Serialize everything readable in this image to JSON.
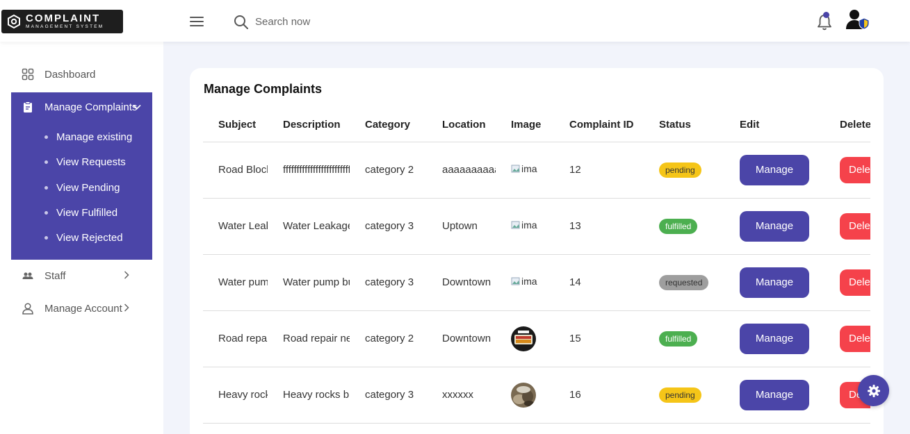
{
  "app": {
    "logo_title": "COMPLAINT",
    "logo_subtitle": "MANAGEMENT SYSTEM"
  },
  "header": {
    "search_placeholder": "Search now",
    "notification_dot_color": "#4b45a8"
  },
  "sidebar": {
    "dashboard": "Dashboard",
    "manage_complaints": "Manage Complaints",
    "sub_items": [
      "Manage existing",
      "View Requests",
      "View Pending",
      "View Fulfilled",
      "View Rejected"
    ],
    "staff": "Staff",
    "manage_account": "Manage Account"
  },
  "main": {
    "title": "Manage Complaints",
    "columns": [
      "Subject",
      "Description",
      "Category",
      "Location",
      "Image",
      "Complaint ID",
      "Status",
      "Edit",
      "Delete"
    ],
    "rows": [
      {
        "subject": "Road Block",
        "description": "fffffffffffffffffffffffffff",
        "category": "category 2",
        "location": "aaaaaaaaaaaa",
        "image": "broken",
        "image_alt": "ima",
        "id": "12",
        "status": "pending",
        "edit": "Manage",
        "delete": "Delete"
      },
      {
        "subject": "Water Leakage",
        "description": "Water Leakage",
        "category": "category 3",
        "location": "Uptown",
        "image": "broken",
        "image_alt": "ima",
        "id": "13",
        "status": "fulfilled",
        "edit": "Manage",
        "delete": "Delete"
      },
      {
        "subject": "Water pump",
        "description": "Water pump bu",
        "category": "category 3",
        "location": "Downtown",
        "image": "broken",
        "image_alt": "ima",
        "id": "14",
        "status": "requested",
        "edit": "Manage",
        "delete": "Delete"
      },
      {
        "subject": "Road repair",
        "description": "Road repair nee",
        "category": "category 2",
        "location": "Downtown",
        "image": "photo-sign",
        "image_alt": "",
        "id": "15",
        "status": "fulfilled",
        "edit": "Manage",
        "delete": "Delete"
      },
      {
        "subject": "Heavy rocks",
        "description": "Heavy rocks blo",
        "category": "category 3",
        "location": "xxxxxx",
        "image": "photo-rocks",
        "image_alt": "",
        "id": "16",
        "status": "pending",
        "edit": "Manage",
        "delete": "Delete"
      }
    ]
  },
  "colors": {
    "accent": "#4b45a8",
    "delete": "#f5424b",
    "pending": "#f5c518",
    "fulfilled": "#4caf50",
    "requested": "#9e9e9e"
  },
  "icons": {
    "logo": "hexagon-logo-icon",
    "menu": "hamburger-icon",
    "search": "search-icon",
    "notifications": "bell-icon",
    "profile": "user-shield-icon",
    "dashboard": "grid-icon",
    "manage": "clipboard-icon",
    "staff": "people-icon",
    "account": "user-icon",
    "settings": "gear-icon"
  }
}
